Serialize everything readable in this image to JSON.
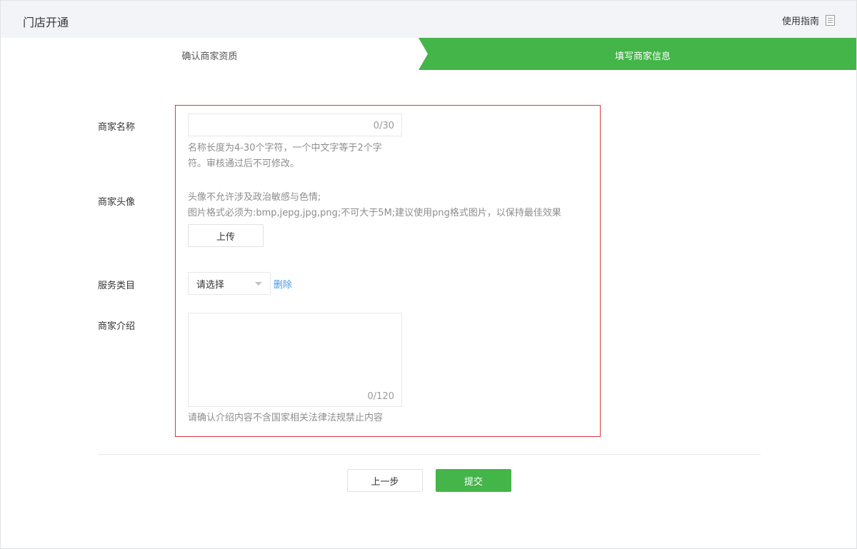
{
  "header": {
    "title": "门店开通",
    "guide_label": "使用指南",
    "guide_icon": "document-icon"
  },
  "steps": [
    {
      "label": "确认商家资质",
      "state": "done"
    },
    {
      "label": "填写商家信息",
      "state": "active"
    }
  ],
  "colors": {
    "accent": "#44b549",
    "highlight_border": "#d9383f",
    "link": "#459ae9"
  },
  "form": {
    "name": {
      "label": "商家名称",
      "value": "",
      "counter": "0/30",
      "tip_line1": "名称长度为4-30个字符，一个中文字等于2个字",
      "tip_line2": "符。审核通过后不可修改。"
    },
    "avatar": {
      "label": "商家头像",
      "tip_line1": "头像不允许涉及政治敏感与色情;",
      "tip_line2": "图片格式必须为:bmp,jepg,jpg,png;不可大于5M;建议使用png格式图片，以保持最佳效果",
      "upload_label": "上传"
    },
    "category": {
      "label": "服务类目",
      "selected": "请选择",
      "delete_label": "删除"
    },
    "intro": {
      "label": "商家介绍",
      "value": "",
      "counter": "0/120",
      "tip": "请确认介绍内容不含国家相关法律法规禁止内容"
    }
  },
  "footer": {
    "prev_label": "上一步",
    "submit_label": "提交"
  }
}
